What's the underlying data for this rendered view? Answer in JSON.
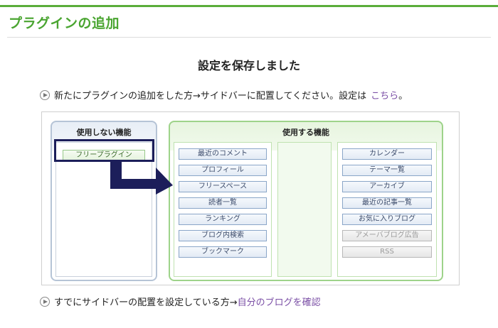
{
  "page": {
    "heading": "プラグインの追加",
    "saved_message": "設定を保存しました",
    "line1_text": "新たにプラグインの追加をした方→サイドバーに配置してください。設定は",
    "line1_link": "こちら",
    "line1_suffix": "。",
    "line2_text": "すでにサイドバーの配置を設定している方→",
    "line2_link": "自分のブログを確認"
  },
  "diagram": {
    "unused_title": "使用しない機能",
    "used_title": "使用する機能",
    "unused_items": [
      "フリープラグイン"
    ],
    "left_column": [
      "最近のコメント",
      "プロフィール",
      "フリースペース",
      "読者一覧",
      "ランキング",
      "ブログ内検索",
      "ブックマーク"
    ],
    "right_column": [
      "カレンダー",
      "テーマ一覧",
      "アーカイブ",
      "最近の記事一覧",
      "お気に入りブログ"
    ],
    "right_column_disabled": [
      "アメーバブログ広告",
      "RSS"
    ]
  }
}
